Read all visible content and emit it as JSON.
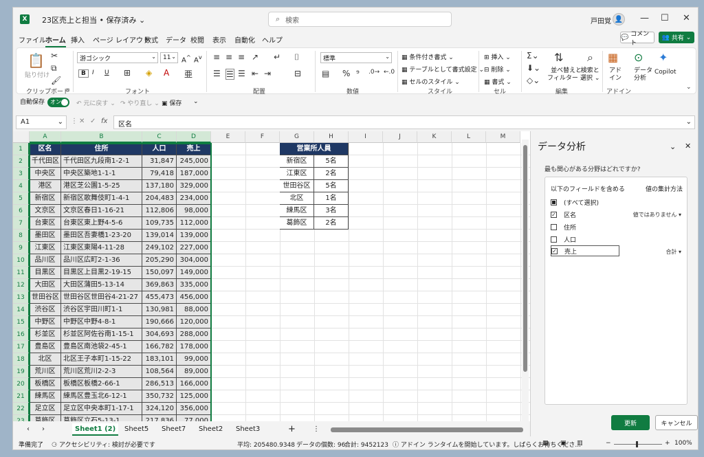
{
  "window": {
    "title": "23区売上と担当 • 保存済み",
    "search_placeholder": "検索",
    "user": "戸田覚"
  },
  "menu": [
    "ファイル",
    "ホーム",
    "挿入",
    "ページ レイアウト",
    "数式",
    "データ",
    "校閲",
    "表示",
    "自動化",
    "ヘルプ"
  ],
  "menu_active": "ホーム",
  "comment_btn": "コメント",
  "share_btn": "共有",
  "ribbon": {
    "paste": "貼り付け",
    "font_name": "游ゴシック",
    "font_size": "11",
    "number_format": "標準",
    "cond_format": "条件付き書式",
    "table_format": "テーブルとして書式設定",
    "cell_style": "セルのスタイル",
    "insert": "挿入",
    "delete": "削除",
    "format": "書式",
    "sort_filter": "並べ替えと\nフィルター",
    "find_select": "検索と\n選択",
    "addin": "アド\nイン",
    "data_analysis": "データ\n分析",
    "copilot": "Copilot",
    "groups": [
      "クリップボード",
      "フォント",
      "配置",
      "数値",
      "スタイル",
      "セル",
      "編集",
      "アドイン"
    ],
    "bold": "B",
    "italic": "I",
    "underline": "U"
  },
  "qat": {
    "autosave": "自動保存",
    "toggle": "オン",
    "undo": "元に戻す",
    "redo": "やり直し",
    "save": "保存"
  },
  "formula": {
    "namebox": "A1",
    "content": "区名"
  },
  "columns": [
    "A",
    "B",
    "C",
    "D",
    "E",
    "F",
    "G",
    "H",
    "I",
    "J",
    "K",
    "L",
    "M"
  ],
  "rows": [
    "1",
    "2",
    "3",
    "4",
    "5",
    "6",
    "7",
    "8",
    "9",
    "10",
    "11",
    "12",
    "13",
    "14",
    "15",
    "16",
    "17",
    "18",
    "19",
    "20",
    "21",
    "22",
    "23"
  ],
  "table": {
    "headers": [
      "区名",
      "住所",
      "人口",
      "売上"
    ],
    "rows": [
      [
        "千代田区",
        "千代田区九段南1-2-1",
        "31,847",
        "245,000"
      ],
      [
        "中央区",
        "中央区築地1-1-1",
        "79,418",
        "187,000"
      ],
      [
        "港区",
        "港区芝公園1-5-25",
        "137,180",
        "329,000"
      ],
      [
        "新宿区",
        "新宿区歌舞伎町1-4-1",
        "204,483",
        "234,000"
      ],
      [
        "文京区",
        "文京区春日1-16-21",
        "112,806",
        "98,000"
      ],
      [
        "台東区",
        "台東区東上野4-5-6",
        "109,735",
        "112,000"
      ],
      [
        "墨田区",
        "墨田区吾妻橋1-23-20",
        "139,014",
        "139,000"
      ],
      [
        "江東区",
        "江東区東陽4-11-28",
        "249,102",
        "227,000"
      ],
      [
        "品川区",
        "品川区広町2-1-36",
        "205,290",
        "304,000"
      ],
      [
        "目黒区",
        "目黒区上目黒2-19-15",
        "150,097",
        "149,000"
      ],
      [
        "大田区",
        "大田区蒲田5-13-14",
        "369,863",
        "335,000"
      ],
      [
        "世田谷区",
        "世田谷区世田谷4-21-27",
        "455,473",
        "456,000"
      ],
      [
        "渋谷区",
        "渋谷区宇田川町1-1",
        "130,981",
        "88,000"
      ],
      [
        "中野区",
        "中野区中野4-8-1",
        "190,666",
        "120,000"
      ],
      [
        "杉並区",
        "杉並区阿佐谷南1-15-1",
        "304,693",
        "288,000"
      ],
      [
        "豊島区",
        "豊島区南池袋2-45-1",
        "166,782",
        "178,000"
      ],
      [
        "北区",
        "北区王子本町1-15-22",
        "183,101",
        "99,000"
      ],
      [
        "荒川区",
        "荒川区荒川2-2-3",
        "108,564",
        "89,000"
      ],
      [
        "板橋区",
        "板橋区板橋2-66-1",
        "286,513",
        "166,000"
      ],
      [
        "練馬区",
        "練馬区豊玉北6-12-1",
        "350,732",
        "125,000"
      ],
      [
        "足立区",
        "足立区中央本町1-17-1",
        "324,120",
        "356,000"
      ],
      [
        "葛飾区",
        "葛飾区立石5-13-1",
        "217,836",
        "77,000"
      ]
    ]
  },
  "staff_table": {
    "header": "営業所人員",
    "rows": [
      [
        "新宿区",
        "5名"
      ],
      [
        "江東区",
        "2名"
      ],
      [
        "世田谷区",
        "5名"
      ],
      [
        "北区",
        "1名"
      ],
      [
        "練馬区",
        "3名"
      ],
      [
        "葛飾区",
        "2名"
      ]
    ]
  },
  "sheets": [
    "Sheet1 (2)",
    "Sheet5",
    "Sheet7",
    "Sheet2",
    "Sheet3"
  ],
  "active_sheet": "Sheet1 (2)",
  "status": {
    "ready": "準備完了",
    "accessibility": "アクセシビリティ: 検討が必要です",
    "average": "平均: 205480.9348",
    "count": "データの個数: 96",
    "sum": "合計: 9452123",
    "addin_msg": "アドイン ランタイムを開始しています。しばらくお待ちくださ...",
    "zoom": "100%"
  },
  "pane": {
    "title": "データ分析",
    "question": "最も関心がある分野はどれですか?",
    "include_fields": "以下のフィールドを含める",
    "aggregate": "値の集計方法",
    "fields": [
      {
        "label": "(すべて選択)",
        "state": "partial",
        "agg": ""
      },
      {
        "label": "区名",
        "state": "checked",
        "agg": "値ではありません"
      },
      {
        "label": "住所",
        "state": "unchecked",
        "agg": ""
      },
      {
        "label": "人口",
        "state": "unchecked",
        "agg": ""
      },
      {
        "label": "売上",
        "state": "checked",
        "agg": "合計"
      }
    ],
    "update": "更新",
    "cancel": "キャンセル"
  },
  "colors": {
    "accent": "#107c41",
    "table_header": "#1f3864",
    "cell_fill": "#e6e6e6"
  }
}
